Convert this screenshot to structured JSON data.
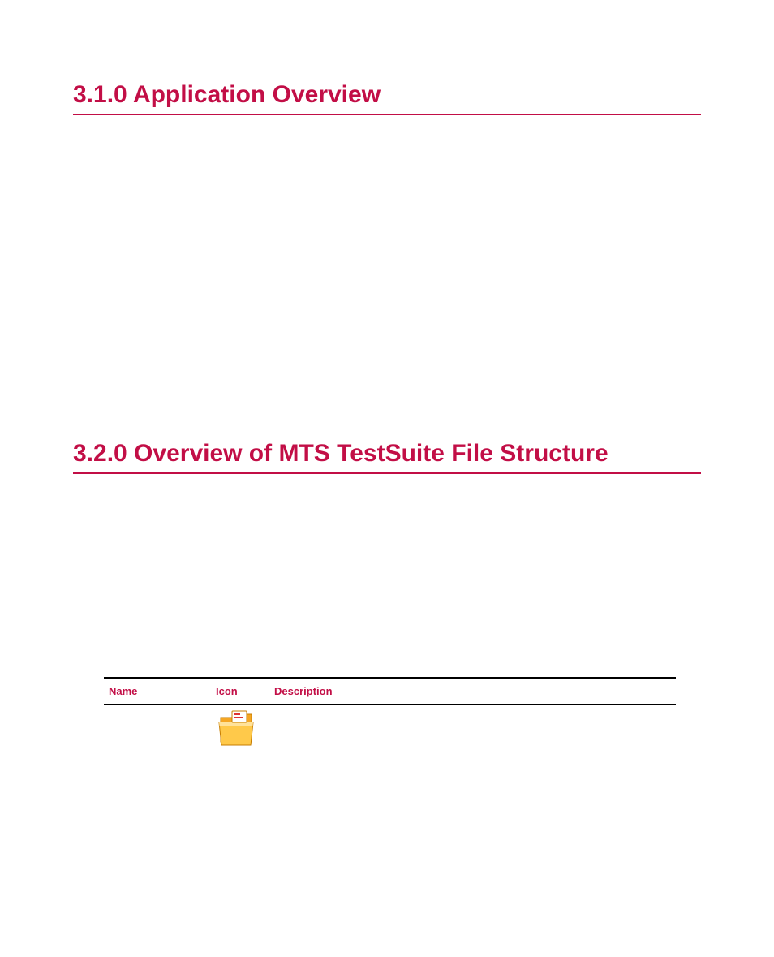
{
  "sections": {
    "app_overview": "3.1.0 Application Overview",
    "file_structure": "3.2.0 Overview of MTS TestSuite File Structure"
  },
  "table": {
    "headers": {
      "name": "Name",
      "icon": "Icon",
      "description": "Description"
    },
    "rows": [
      {
        "name": "",
        "description": ""
      }
    ]
  }
}
